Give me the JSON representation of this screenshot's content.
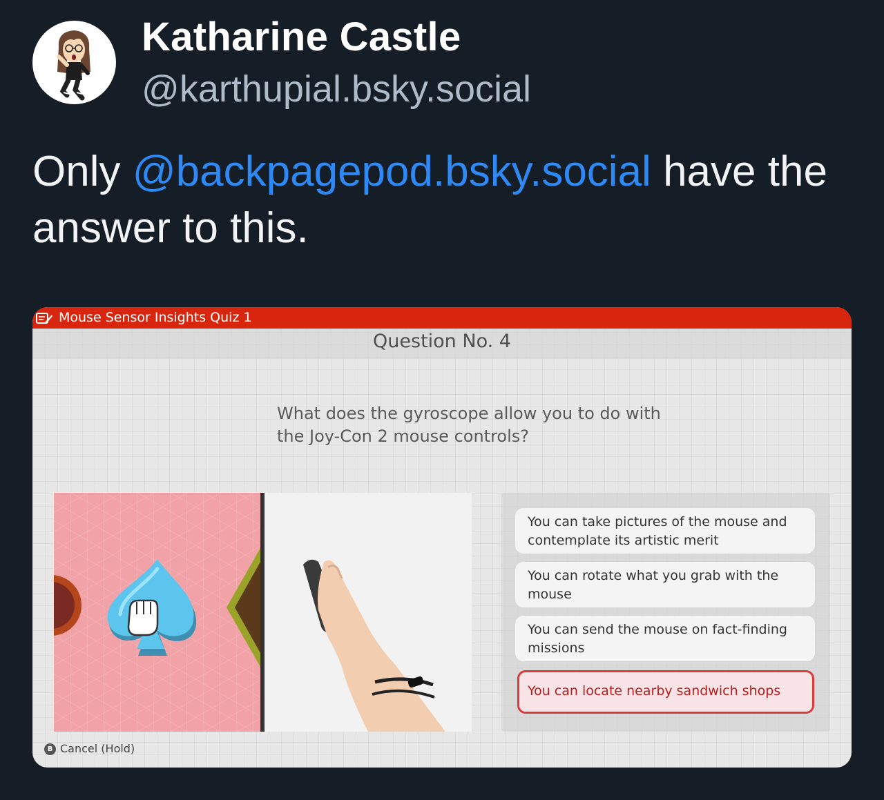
{
  "author": {
    "name": "Katharine Castle",
    "handle": "@karthupial.bsky.social",
    "avatar_icon": "mii-avatar-icon"
  },
  "post": {
    "text_before": "Only ",
    "mention": "@backpagepod.bsky.social",
    "text_after": " have the answer to this."
  },
  "embed": {
    "quiz_title": "Mouse Sensor Insights Quiz 1",
    "question_number": "Question No. 4",
    "question": "What does the gyroscope allow you to do with the Joy-Con 2 mouse controls?",
    "answers": [
      {
        "text": "You can take pictures of the mouse and contemplate its artistic merit",
        "selected": false
      },
      {
        "text": "You can rotate what you grab with the mouse",
        "selected": false
      },
      {
        "text": "You can send the mouse on fact-finding missions",
        "selected": false
      },
      {
        "text": "You can locate nearby sandwich shops",
        "selected": true
      }
    ],
    "cancel_button_glyph": "B",
    "cancel_label": "Cancel (Hold)",
    "colors": {
      "quiz_bar": "#d8250e",
      "selected_border": "#d93b3b",
      "mention": "#2f89f5"
    }
  }
}
